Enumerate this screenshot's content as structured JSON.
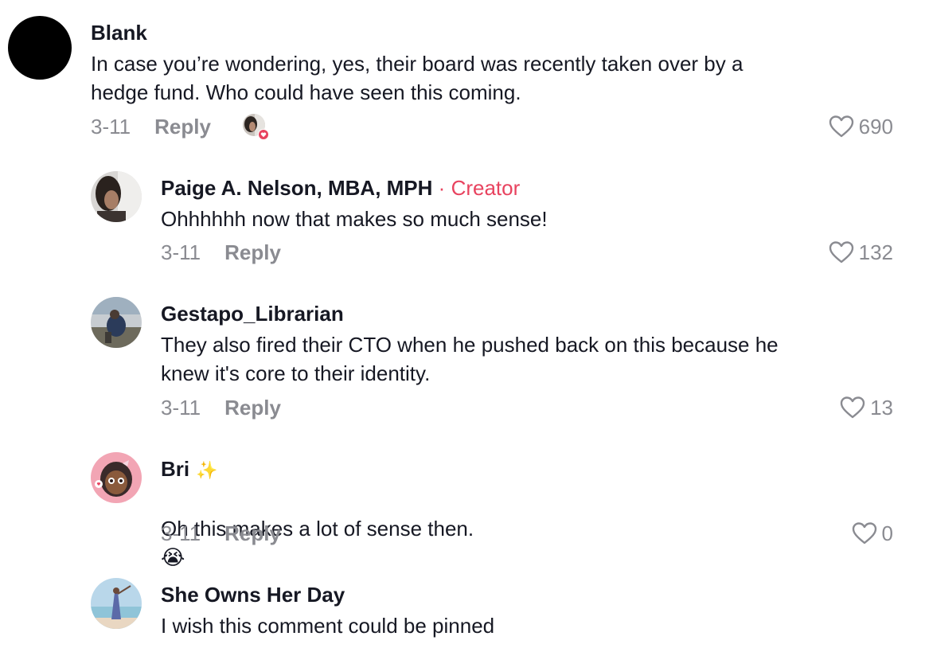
{
  "comments": [
    {
      "name": "Blank",
      "text": "In case you’re wondering, yes, their board was recently taken over by a\nhedge fund. Who could have seen this coming.",
      "date": "3-11",
      "reply": "Reply",
      "likes": "690",
      "avatar_color": "#000000"
    },
    {
      "name": "Paige A. Nelson, MBA, MPH",
      "creator_sep": "·",
      "creator_label": "Creator",
      "text": "Ohhhhhh now that makes so much sense!",
      "date": "3-11",
      "reply": "Reply",
      "likes": "132"
    },
    {
      "name": "Gestapo_Librarian",
      "text": "They also fired their CTO when he pushed back on this because he\nknew it's core to their identity.",
      "date": "3-11",
      "reply": "Reply",
      "likes": "13"
    },
    {
      "name": "Bri",
      "name_suffix": "✨",
      "text": "Oh this makes a lot of sense then.",
      "text_emoji": "😭",
      "date": "3-11",
      "reply": "Reply",
      "likes": "0"
    },
    {
      "name": "She Owns Her Day",
      "text": "I wish this comment could be pinned"
    }
  ],
  "colors": {
    "accent_creator": "#e8435f",
    "muted": "#8a8b91",
    "text": "#161823"
  }
}
